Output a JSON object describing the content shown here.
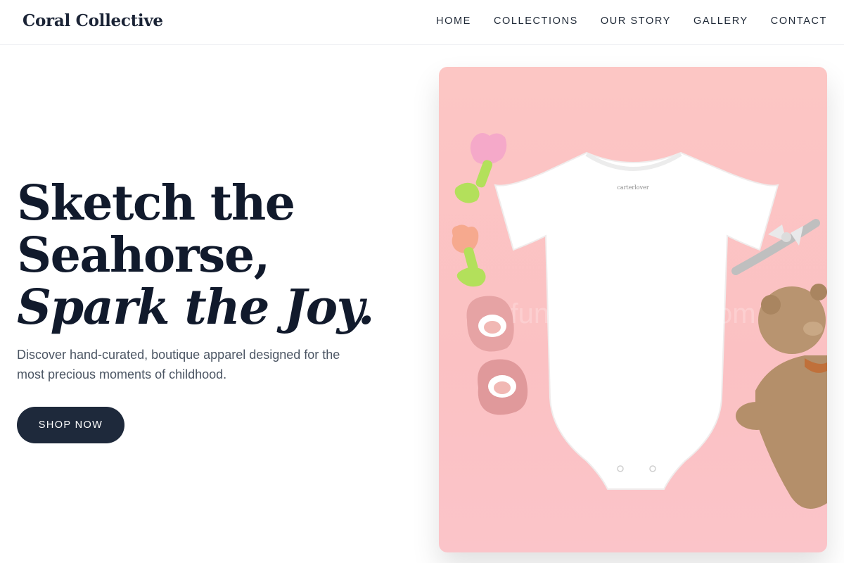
{
  "header": {
    "brand": "Coral Collective",
    "nav": [
      {
        "label": "HOME"
      },
      {
        "label": "COLLECTIONS"
      },
      {
        "label": "OUR STORY"
      },
      {
        "label": "GALLERY"
      },
      {
        "label": "CONTACT"
      }
    ]
  },
  "hero": {
    "title_line1": "Sketch the",
    "title_line2": "Seahorse,",
    "title_line3": "Spark the Joy.",
    "subtitle": "Discover hand-curated, boutique apparel designed for the most precious moments of childhood.",
    "cta_label": "SHOP NOW",
    "image": {
      "label_text": "carterlover",
      "watermark": "funnyseahorse.com",
      "colors": {
        "background": "#fcc6c4",
        "onesie": "#ffffff",
        "teether_pink": "#f5a9c9",
        "teether_peach": "#f6a98e",
        "teether_green": "#b3e05b",
        "bear": "#b89470"
      }
    }
  },
  "colors": {
    "brand_dark": "#1e293b",
    "text_body": "#4b5563"
  }
}
